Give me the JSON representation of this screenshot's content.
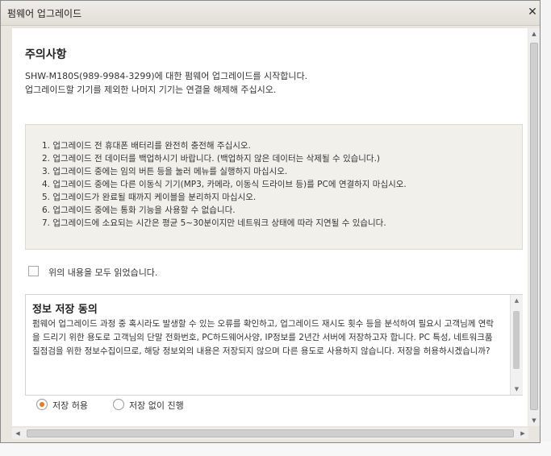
{
  "window": {
    "title": "펌웨어 업그레이드",
    "close_glyph": "✕"
  },
  "notice": {
    "heading": "주의사항",
    "line1": "SHW-M180S(989-9984-3299)에 대한 펌웨어 업그레이드를 시작합니다.",
    "line2": "업그레이드할 기기를 제외한 나머지 기기는 연결을 해제해 주십시오."
  },
  "rules": [
    "1. 업그레이드 전 휴대폰 배터리를 완전히 충전해 주십시오.",
    "2. 업그레이드 전 데이터를 백업하시기 바랍니다. (백업하지 않은 데이터는 삭제될 수 있습니다.)",
    "3. 업그레이드 중에는 임의 버튼 등을 눌러 메뉴를 실행하지 마십시오.",
    "4. 업그레이드 중에는 다른 이동식 기기(MP3, 카메라, 이동식 드라이브 등)를 PC에 연결하지 마십시오.",
    "5. 업그레이드가 완료될 때까지 케이블을 분리하지 마십시오.",
    "6. 업그레이드 중에는 통화 기능을 사용할 수 없습니다.",
    "7. 업그레이드에 소요되는 시간은 평균 5~30분이지만 네트워크 상태에 따라 지연될 수 있습니다."
  ],
  "agree": {
    "label": "위의 내용을 모두 읽었습니다.",
    "checked": false
  },
  "consent": {
    "title": "정보 저장 동의",
    "body": "펌웨어 업그레이드 과정 중 혹시라도 발생할 수 있는 오류를 확인하고, 업그레이드 재시도 횟수 등을 분석하여 필요시 고객님께 연락을 드리기 위한 용도로 고객님의 단말 전화번호, PC하드웨어사양, IP정보를 2년간 서버에 저장하고자 합니다. PC 특성, 네트워크품질점검을 위한 정보수집이므로, 해당 정보외의 내용은 저장되지 않으며 다른 용도로 사용하지 않습니다. 저장을 허용하시겠습니까?",
    "options": [
      {
        "label": "저장 허용",
        "selected": true
      },
      {
        "label": "저장 없이 진행",
        "selected": false
      }
    ]
  },
  "colors": {
    "radio_accent": "#e87a1e",
    "dialog_frame": "#e9e6df",
    "rules_background": "#f1f0ea"
  },
  "icons": {
    "close": "close-icon",
    "scroll_up": "arrow-up-icon",
    "scroll_down": "arrow-down-icon",
    "scroll_left": "arrow-left-icon",
    "scroll_right": "arrow-right-icon"
  }
}
